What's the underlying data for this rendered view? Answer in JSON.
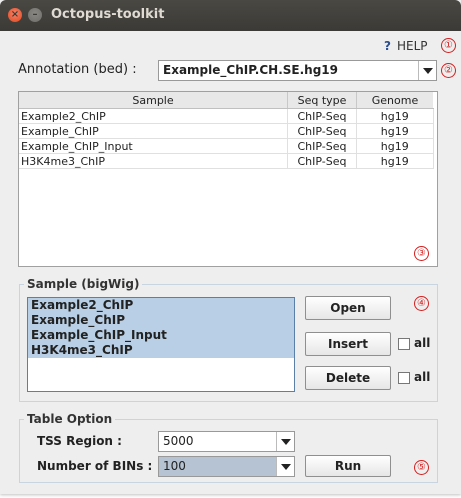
{
  "window": {
    "title": "Octopus-toolkit"
  },
  "help": {
    "icon": "?",
    "label": "HELP"
  },
  "markers": [
    "①",
    "②",
    "③",
    "④",
    "⑤"
  ],
  "annotation": {
    "label": "Annotation (bed) :",
    "value": "Example_ChIP.CH.SE.hg19"
  },
  "table": {
    "columns": [
      "Sample",
      "Seq type",
      "Genome"
    ],
    "rows": [
      [
        "Example2_ChIP",
        "ChIP-Seq",
        "hg19"
      ],
      [
        "Example_ChIP",
        "ChIP-Seq",
        "hg19"
      ],
      [
        "Example_ChIP_Input",
        "ChIP-Seq",
        "hg19"
      ],
      [
        "H3K4me3_ChIP",
        "ChIP-Seq",
        "hg19"
      ]
    ]
  },
  "sample_panel": {
    "title": "Sample (bigWig)",
    "items": [
      "Example2_ChIP",
      "Example_ChIP",
      "Example_ChIP_Input",
      "H3K4me3_ChIP"
    ],
    "open_label": "Open",
    "insert_label": "Insert",
    "delete_label": "Delete",
    "insert_all_label": "all",
    "delete_all_label": "all"
  },
  "table_option": {
    "title": "Table Option",
    "tss_label": "TSS Region :",
    "tss_value": "5000",
    "bins_label": "Number of BINs :",
    "bins_value": "100",
    "run_label": "Run"
  },
  "colors": {
    "marker": "#d32020",
    "selection": "#b8cfe5",
    "titlebar": "#3c3b37"
  }
}
